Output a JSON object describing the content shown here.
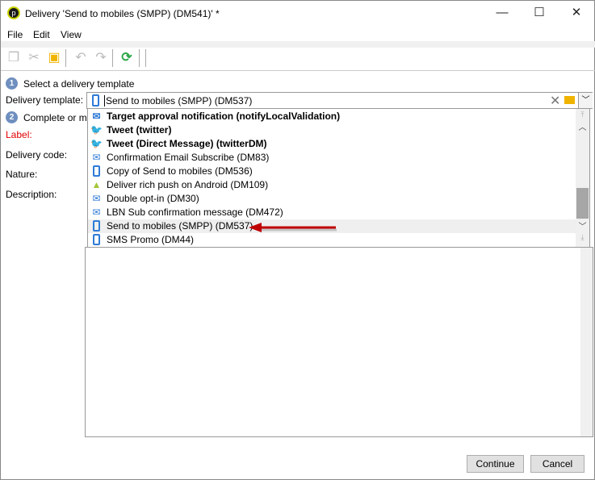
{
  "window": {
    "title": "Delivery 'Send to mobiles (SMPP) (DM541)' *",
    "minimize": "—",
    "maximize": "☐",
    "close": "✕"
  },
  "menu": [
    "File",
    "Edit",
    "View"
  ],
  "steps": {
    "step1_number": "1",
    "step1": "Select a delivery template",
    "step2_number": "2",
    "step2": "Complete or m"
  },
  "form": {
    "template_label": "Delivery template:",
    "template_value": "Send to mobiles (SMPP) (DM537)",
    "label_label": "Label:",
    "code_label": "Delivery code:",
    "nature_label": "Nature:",
    "description_label": "Description:"
  },
  "dropdown": {
    "items": [
      {
        "label": "Target approval notification (notifyLocalValidation)",
        "icon": "mail",
        "bold": true
      },
      {
        "label": "Tweet (twitter)",
        "icon": "twitter",
        "bold": true
      },
      {
        "label": "Tweet (Direct Message) (twitterDM)",
        "icon": "twitter",
        "bold": true
      },
      {
        "label": "Confirmation Email Subscribe (DM83)",
        "icon": "mail",
        "bold": false
      },
      {
        "label": "Copy of Send to mobiles (DM536)",
        "icon": "mobile",
        "bold": false
      },
      {
        "label": "Deliver rich push on Android (DM109)",
        "icon": "android",
        "bold": false
      },
      {
        "label": "Double opt-in (DM30)",
        "icon": "mail",
        "bold": false
      },
      {
        "label": "LBN Sub confirmation message (DM472)",
        "icon": "mail",
        "bold": false
      },
      {
        "label": "Send to mobiles (SMPP) (DM537)",
        "icon": "mobile",
        "bold": false,
        "selected": true
      },
      {
        "label": "SMS Promo (DM44)",
        "icon": "mobile",
        "bold": false
      }
    ]
  },
  "buttons": {
    "continue": "Continue",
    "cancel": "Cancel"
  },
  "colors": {
    "label_required": "#e00000",
    "arrow": "#c00000",
    "folder": "#f0b400",
    "refresh": "#2ea84a"
  }
}
